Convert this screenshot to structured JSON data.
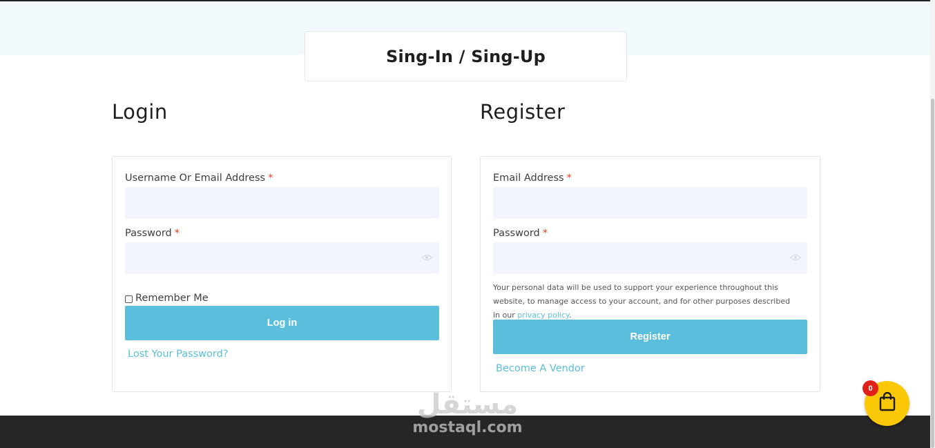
{
  "page_title": "Sing-In / Sing-Up",
  "login": {
    "heading": "Login",
    "username_label": "Username Or Email Address",
    "username_value": "",
    "password_label": "Password",
    "password_value": "",
    "required_mark": "*",
    "remember_label": "Remember Me",
    "remember_checked": false,
    "submit_label": "Log in",
    "lost_password_link": "Lost Your Password?"
  },
  "register": {
    "heading": "Register",
    "email_label": "Email Address",
    "email_value": "",
    "password_label": "Password",
    "password_value": "",
    "required_mark": "*",
    "privacy_text": "Your personal data will be used to support your experience throughout this website, to manage access to your account, and for other purposes described in our ",
    "privacy_link": "privacy policy",
    "privacy_suffix": ".",
    "submit_label": "Register",
    "vendor_link": "Become A Vendor"
  },
  "watermark": {
    "arabic": "مستقل",
    "latin": "mostaql.com"
  },
  "cart": {
    "count": "0",
    "icon": "shopping-bag-icon"
  },
  "colors": {
    "accent": "#5bbedc",
    "required": "#e2401c",
    "cart_bg": "#fbc807",
    "badge_bg": "#e0201b",
    "footer_bg": "#262626",
    "hero_bg": "#f1f9fb",
    "input_bg": "#f2f5fd"
  }
}
